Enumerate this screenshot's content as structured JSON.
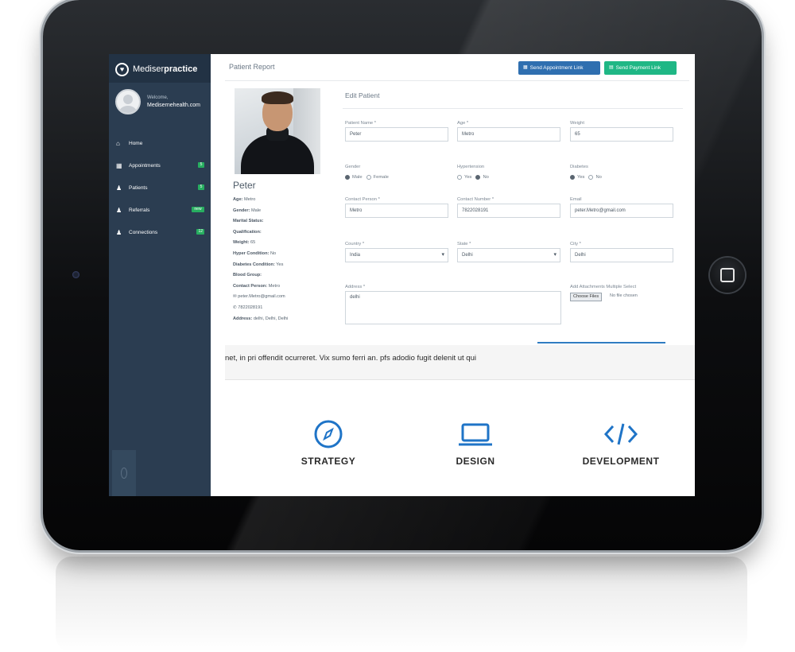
{
  "sidebar": {
    "brand_light": "Mediser",
    "brand_bold": "practice",
    "welcome_label": "Welcome,",
    "welcome_email": "Medisernehealth.com",
    "items": [
      {
        "label": "Home",
        "icon": "home-icon",
        "badge": ""
      },
      {
        "label": "Appointments",
        "icon": "calendar-icon",
        "badge": "5"
      },
      {
        "label": "Patients",
        "icon": "user-icon",
        "badge": "5"
      },
      {
        "label": "Referrals",
        "icon": "user-icon",
        "badge": "new"
      },
      {
        "label": "Connections",
        "icon": "connections-icon",
        "badge": "12"
      }
    ]
  },
  "header": {
    "title": "Patient Report",
    "send_appointment": "Send Appointment Link",
    "send_payment": "Send Payment Link"
  },
  "profile": {
    "name": "Peter",
    "details": [
      {
        "label": "Age:",
        "value": "Metro"
      },
      {
        "label": "Gender:",
        "value": "Male"
      },
      {
        "label": "Marital Status:",
        "value": ""
      },
      {
        "label": "Qualification:",
        "value": ""
      },
      {
        "label": "Weight:",
        "value": "65"
      },
      {
        "label": "Hyper Condition:",
        "value": "No"
      },
      {
        "label": "Diabetes Condition:",
        "value": "Yes"
      },
      {
        "label": "Blood Group:",
        "value": ""
      },
      {
        "label": "Contact Person:",
        "value": "Metro"
      }
    ],
    "email": "peter.Metro@gmail.com",
    "phone": "7822028191",
    "address_label": "Address:",
    "address_value": "delhi, Delhi, Delhi"
  },
  "form": {
    "title": "Edit Patient",
    "patient_name_label": "Patient Name *",
    "patient_name_value": "Peter",
    "age_label": "Age *",
    "age_value": "Metro",
    "weight_label": "Weight",
    "weight_value": "65",
    "gender_label": "Gender",
    "gender_male": "Male",
    "gender_female": "Female",
    "hypertension_label": "Hypertension",
    "diabetes_label": "Diabetes",
    "yes": "Yes",
    "no": "No",
    "contact_person_label": "Contact Person *",
    "contact_person_value": "Metro",
    "contact_number_label": "Contact Number *",
    "contact_number_value": "7822028191",
    "email_label": "Email",
    "email_value": "peter.Metro@gmail.com",
    "country_label": "Country *",
    "country_value": "India",
    "state_label": "State *",
    "state_value": "Delhi",
    "city_label": "City *",
    "city_value": "Delhi",
    "address_label": "Address *",
    "address_value": "delhi",
    "attachments_label": "Add Attachments Multiple Select",
    "choose_files": "Choose Files",
    "no_file": "No file chosen"
  },
  "strip_text": "net, in pri offendit ocurreret. Vix sumo ferri an. pfs adodio fugit delenit ut qui",
  "features": [
    {
      "label": "STRATEGY",
      "icon": "compass-icon"
    },
    {
      "label": "DESIGN",
      "icon": "laptop-icon"
    },
    {
      "label": "DEVELOPMENT",
      "icon": "code-icon"
    }
  ],
  "colors": {
    "sidebar": "#2b3d51",
    "primary_button": "#2f6fb0",
    "success_button": "#1fb785",
    "feature_icon": "#1f74c7"
  }
}
